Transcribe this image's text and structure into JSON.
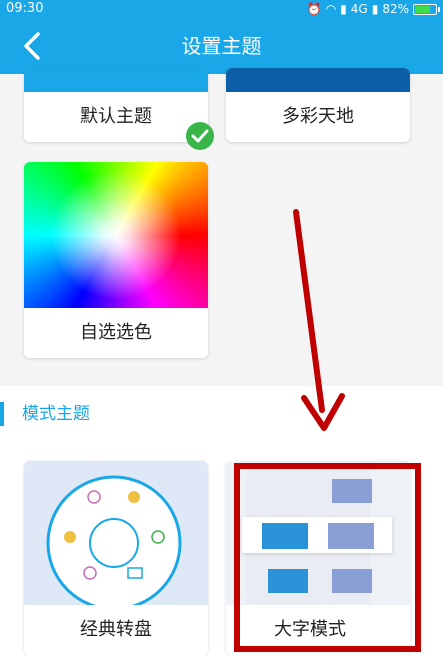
{
  "status": {
    "time": "09:30",
    "network": "4G",
    "battery": "82%",
    "battery_level": 0.82
  },
  "header": {
    "title": "设置主题"
  },
  "themes": {
    "default_label": "默认主题",
    "colorful_label": "多彩天地",
    "custom_label": "自选选色"
  },
  "mode_section": {
    "title": "模式主题",
    "classic_label": "经典转盘",
    "large_label": "大字模式"
  },
  "colors": {
    "accent": "#1aa7e8",
    "check": "#3ab54a",
    "annotation": "#c00000"
  }
}
